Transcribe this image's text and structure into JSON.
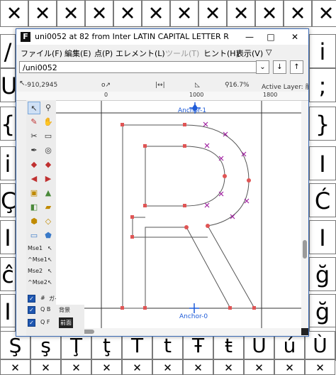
{
  "background_glyphs": {
    "top_row": [
      "✕",
      "✕",
      "✕",
      "✕",
      "✕",
      "✕",
      "✕",
      "✕",
      "✕",
      "✕",
      "✕",
      "✕"
    ],
    "left_column": [
      "/",
      "U",
      "{",
      "i",
      "Ç",
      "I",
      "ĉ",
      "I",
      "ğ"
    ],
    "right_column": [
      "i",
      ";",
      "}",
      "I",
      "Ć",
      "I",
      "ğ",
      "ğ",
      "N"
    ],
    "bottom_row_1": [
      "Ş",
      "ş",
      "Ţ",
      "ţ",
      "T",
      "t",
      "Ŧ",
      "ŧ",
      "Ú",
      "ú",
      "Ù"
    ],
    "bottom_row_2": [
      "✕",
      "✕",
      "✕",
      "✕",
      "✕",
      "✕",
      "✕",
      "✕",
      "✕",
      "✕",
      "✕"
    ]
  },
  "window": {
    "title": "uni0052 at 82 from Inter LATIN CAPITAL LETTER R",
    "app_icon": "fontforge-icon",
    "controls": {
      "minimize": "—",
      "maximize": "□",
      "close": "✕"
    },
    "menu": [
      {
        "label": "ファイル(F)",
        "enabled": true
      },
      {
        "label": "編集(E)",
        "enabled": true
      },
      {
        "label": "点(P)",
        "enabled": true
      },
      {
        "label": "エレメント(L)",
        "enabled": true
      },
      {
        "label": "ツール(T)",
        "enabled": false
      },
      {
        "label": "ヒント(H)",
        "enabled": true
      },
      {
        "label": "表示(V)",
        "enabled": true
      }
    ],
    "menu_overflow": "▽",
    "glyph_name_value": "/uni0052",
    "nav_buttons": [
      "⌄",
      "↓",
      "↑"
    ],
    "info": {
      "cursor_pos": "-910,2945",
      "zoom": "16.7%",
      "active_layer": "Active Layer: 前面"
    },
    "ruler": {
      "labels": [
        "0",
        "1000",
        "1800"
      ]
    },
    "tools": {
      "mse_labels": [
        "Mse1",
        "^Mse1",
        "Mse2",
        "^Mse2"
      ]
    },
    "layers": [
      {
        "code": "#",
        "name": "ガイド",
        "checked": true
      },
      {
        "code": "Q  B",
        "name": "背景",
        "checked": true
      },
      {
        "code": "Q  F",
        "name": "前面",
        "checked": true
      }
    ],
    "canvas": {
      "anchor_top": "Anchor-1",
      "anchor_bottom": "Anchor-0",
      "outline_color": "#555555",
      "point_color": "#e05555",
      "control_color": "#a020a0",
      "guide_color": "#333333",
      "anchor_color": "#1e5bd8"
    }
  },
  "colors": {
    "accent": "#3d6cb5",
    "checkbox": "#1e56b0"
  }
}
